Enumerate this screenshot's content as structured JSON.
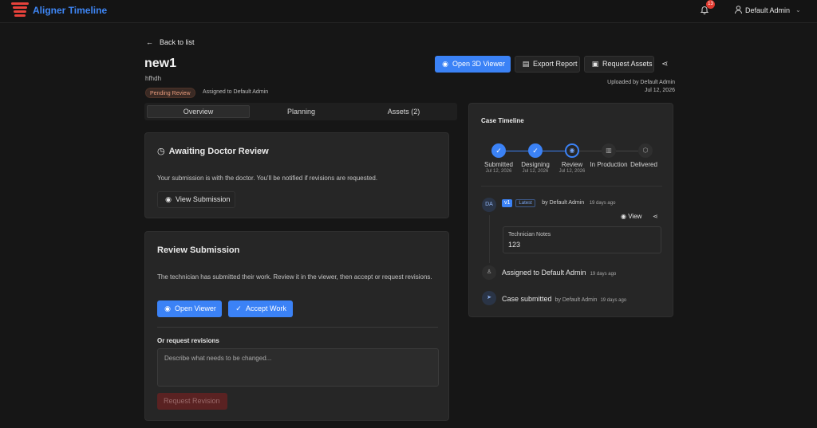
{
  "app": {
    "brand": "Aligner Timeline",
    "notification_count": "13",
    "user_name": "Default Admin"
  },
  "nav": {
    "back_label": "Back to list"
  },
  "case": {
    "title": "new1",
    "subtitle": "hfhdh",
    "status": "Pending Review",
    "assigned_to": "Assigned to Default Admin",
    "uploaded_by": "Uploaded by Default Admin",
    "uploaded_date": "Jul 12, 2026"
  },
  "actions": {
    "open_3d_viewer": "Open 3D Viewer",
    "export_report": "Export Report",
    "request_assets": "Request Assets"
  },
  "tabs": [
    {
      "label": "Overview",
      "active": true
    },
    {
      "label": "Planning",
      "active": false
    },
    {
      "label": "Assets (2)",
      "active": false
    }
  ],
  "awaiting": {
    "title": "Awaiting Doctor Review",
    "message": "Your submission is with the doctor. You'll be notified if revisions are requested.",
    "view_submission": "View Submission"
  },
  "review": {
    "title": "Review Submission",
    "message": "The technician has submitted their work. Review it in the viewer, then accept or request revisions.",
    "open_viewer": "Open Viewer",
    "accept_work": "Accept Work",
    "revisions_label": "Or request revisions",
    "revisions_placeholder": "Describe what needs to be changed...",
    "request_revision": "Request Revision"
  },
  "timeline": {
    "title": "Case Timeline",
    "steps": [
      {
        "label": "Submitted",
        "date": "Jul 12, 2026",
        "state": "done"
      },
      {
        "label": "Designing",
        "date": "Jul 12, 2026",
        "state": "done"
      },
      {
        "label": "Review",
        "date": "Jul 12, 2026",
        "state": "current"
      },
      {
        "label": "In Production",
        "date": "",
        "state": "todo"
      },
      {
        "label": "Delivered",
        "date": "",
        "state": "todo"
      }
    ],
    "version": {
      "avatar": "DA",
      "tag": "v1",
      "latest": "Latest",
      "by": "by Default Admin",
      "ago": "19 days ago",
      "view_label": "View",
      "notes_label": "Technician Notes",
      "notes_value": "123"
    },
    "events": [
      {
        "text": "Assigned to Default Admin",
        "by": "",
        "ago": "19 days ago"
      },
      {
        "text": "Case submitted",
        "by": "by Default Admin",
        "ago": "19 days ago"
      }
    ]
  },
  "colors": {
    "accent": "#3b82f6",
    "brand_red": "#e8423b",
    "background": "#161616",
    "card": "#262626"
  }
}
